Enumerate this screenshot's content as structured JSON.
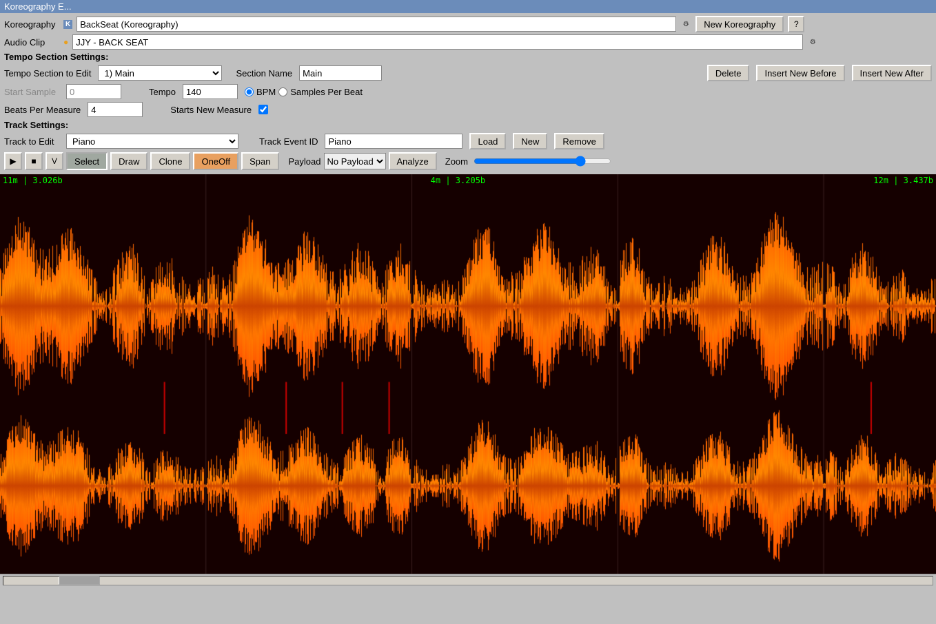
{
  "titleBar": {
    "label": "Koreography E..."
  },
  "header": {
    "koreographyLabel": "Koreography",
    "koreographyValue": "BackSeat (Koreography)",
    "koreographyIcon": "K",
    "newKoreographyBtn": "New Koreography",
    "helpBtn": "?",
    "audioClipLabel": "Audio Clip",
    "audioClipValue": "JJY - BACK SEAT",
    "audioClipIcon": "●"
  },
  "tempoSection": {
    "sectionLabel": "Tempo Section Settings:",
    "tempoSectionLabel": "Tempo Section to Edit",
    "tempoSectionValue": "1) Main",
    "sectionNameLabel": "Section Name",
    "sectionNameValue": "Main",
    "deleteBtn": "Delete",
    "insertBeforeBtn": "Insert New Before",
    "insertAfterBtn": "Insert New After",
    "startSampleLabel": "Start Sample",
    "startSampleValue": "0",
    "tempoLabel": "Tempo",
    "tempoValue": "140",
    "bpmLabel": "BPM",
    "samplesPerBeatLabel": "Samples Per Beat",
    "beatsPerMeasureLabel": "Beats Per Measure",
    "beatsPerMeasureValue": "4",
    "startsNewMeasureLabel": "Starts New Measure",
    "startsNewMeasureChecked": true
  },
  "trackSection": {
    "sectionLabel": "Track Settings:",
    "trackToEditLabel": "Track to Edit",
    "trackToEditValue": "Piano",
    "trackEventIDLabel": "Track Event ID",
    "trackEventIDValue": "Piano",
    "loadBtn": "Load",
    "newBtn": "New",
    "removeBtn": "Remove"
  },
  "toolbar": {
    "playBtn": "▶",
    "stopBtn": "■",
    "vBtn": "V",
    "selectBtn": "Select",
    "drawBtn": "Draw",
    "cloneBtn": "Clone",
    "oneOffBtn": "OneOff",
    "spanBtn": "Span",
    "payloadLabel": "Payload",
    "payloadValue": "No Payload",
    "analyzeBtn": "Analyze",
    "zoomLabel": "Zoom"
  },
  "waveform": {
    "markers": [
      {
        "label": "11m | 3.026b",
        "position": 0
      },
      {
        "label": "4m | 3.205b",
        "position": 43
      },
      {
        "label": "12m | 3.437b",
        "position": 88
      }
    ]
  }
}
